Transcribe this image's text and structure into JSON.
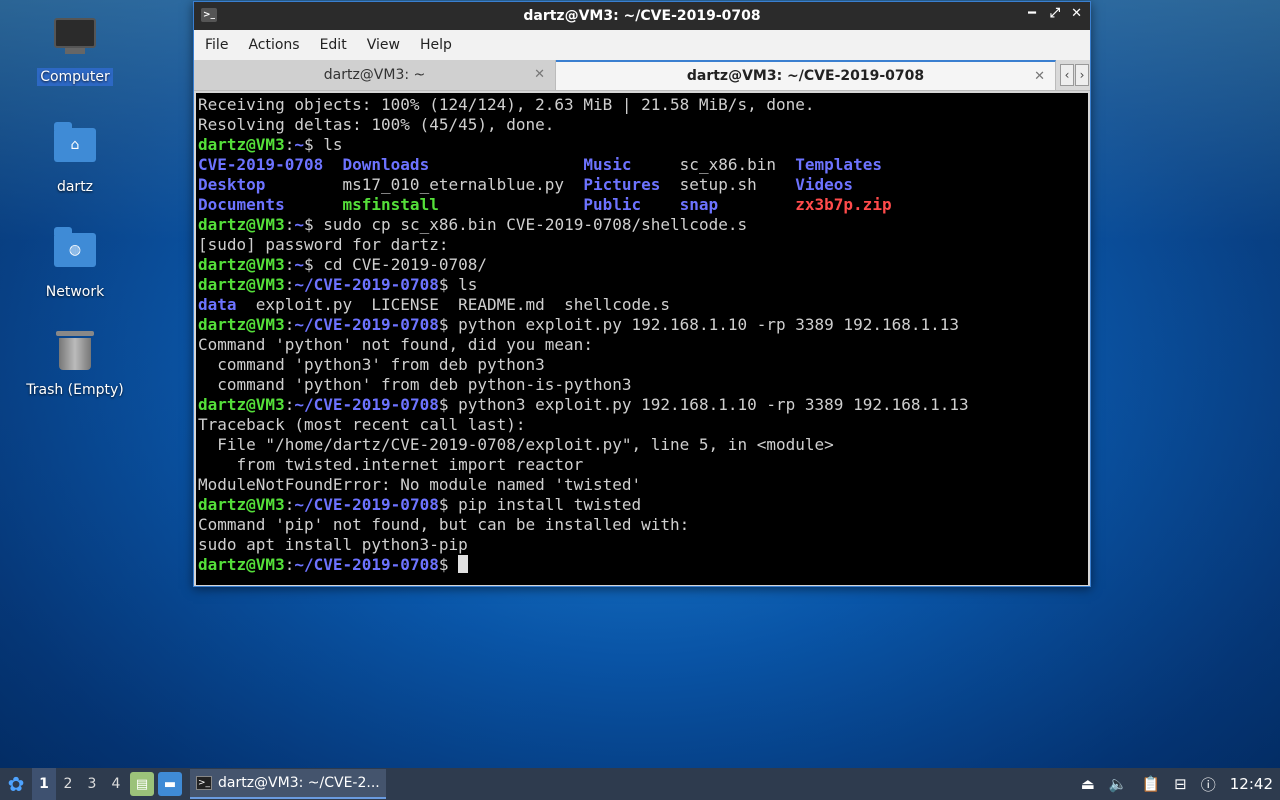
{
  "desktop": {
    "icons": [
      {
        "label": "Computer"
      },
      {
        "label": "dartz"
      },
      {
        "label": "Network"
      },
      {
        "label": "Trash (Empty)"
      }
    ]
  },
  "window": {
    "title": "dartz@VM3: ~/CVE-2019-0708",
    "menu": [
      "File",
      "Actions",
      "Edit",
      "View",
      "Help"
    ],
    "tabs": [
      {
        "label": "dartz@VM3: ~",
        "active": false
      },
      {
        "label": "dartz@VM3: ~/CVE-2019-0708",
        "active": true
      }
    ]
  },
  "terminal": {
    "lines": [
      {
        "type": "out",
        "text": "Receiving objects: 100% (124/124), 2.63 MiB | 21.58 MiB/s, done."
      },
      {
        "type": "out",
        "text": "Resolving deltas: 100% (45/45), done."
      },
      {
        "type": "cmd",
        "user": "dartz@VM3",
        "path": "~",
        "cmd": " ls"
      },
      {
        "type": "ls",
        "cells": [
          {
            "t": "CVE-2019-0708",
            "c": "dir"
          },
          {
            "t": "Downloads",
            "c": "dir"
          },
          {
            "t": "Music",
            "c": "dir"
          },
          {
            "t": "sc_x86.bin",
            "c": "file"
          },
          {
            "t": "Templates",
            "c": "dir"
          }
        ]
      },
      {
        "type": "ls",
        "cells": [
          {
            "t": "Desktop",
            "c": "dir"
          },
          {
            "t": "ms17_010_eternalblue.py",
            "c": "file"
          },
          {
            "t": "Pictures",
            "c": "dir"
          },
          {
            "t": "setup.sh",
            "c": "file"
          },
          {
            "t": "Videos",
            "c": "dir"
          }
        ]
      },
      {
        "type": "ls",
        "cells": [
          {
            "t": "Documents",
            "c": "dir"
          },
          {
            "t": "msfinstall",
            "c": "exe"
          },
          {
            "t": "Public",
            "c": "dir"
          },
          {
            "t": "snap",
            "c": "dir"
          },
          {
            "t": "zx3b7p.zip",
            "c": "arc"
          }
        ]
      },
      {
        "type": "cmd",
        "user": "dartz@VM3",
        "path": "~",
        "cmd": " sudo cp sc_x86.bin CVE-2019-0708/shellcode.s"
      },
      {
        "type": "out",
        "text": "[sudo] password for dartz:"
      },
      {
        "type": "cmd",
        "user": "dartz@VM3",
        "path": "~",
        "cmd": " cd CVE-2019-0708/"
      },
      {
        "type": "cmd",
        "user": "dartz@VM3",
        "path": "~/CVE-2019-0708",
        "cmd": " ls"
      },
      {
        "type": "ls2",
        "cells": [
          {
            "t": "data",
            "c": "dir"
          },
          {
            "t": "exploit.py",
            "c": "file"
          },
          {
            "t": "LICENSE",
            "c": "file"
          },
          {
            "t": "README.md",
            "c": "file"
          },
          {
            "t": "shellcode.s",
            "c": "file"
          }
        ]
      },
      {
        "type": "cmd",
        "user": "dartz@VM3",
        "path": "~/CVE-2019-0708",
        "cmd": " python exploit.py 192.168.1.10 -rp 3389 192.168.1.13"
      },
      {
        "type": "out",
        "text": "Command 'python' not found, did you mean:"
      },
      {
        "type": "out",
        "text": "  command 'python3' from deb python3"
      },
      {
        "type": "out",
        "text": "  command 'python' from deb python-is-python3"
      },
      {
        "type": "cmd",
        "user": "dartz@VM3",
        "path": "~/CVE-2019-0708",
        "cmd": " python3 exploit.py 192.168.1.10 -rp 3389 192.168.1.13"
      },
      {
        "type": "out",
        "text": "Traceback (most recent call last):"
      },
      {
        "type": "out",
        "text": "  File \"/home/dartz/CVE-2019-0708/exploit.py\", line 5, in <module>"
      },
      {
        "type": "out",
        "text": "    from twisted.internet import reactor"
      },
      {
        "type": "out",
        "text": "ModuleNotFoundError: No module named 'twisted'"
      },
      {
        "type": "cmd",
        "user": "dartz@VM3",
        "path": "~/CVE-2019-0708",
        "cmd": " pip install twisted"
      },
      {
        "type": "out",
        "text": "Command 'pip' not found, but can be installed with:"
      },
      {
        "type": "out",
        "text": "sudo apt install python3-pip"
      },
      {
        "type": "prompt",
        "user": "dartz@VM3",
        "path": "~/CVE-2019-0708",
        "cmd": " "
      }
    ]
  },
  "taskbar": {
    "workspaces": [
      "1",
      "2",
      "3",
      "4"
    ],
    "current_workspace": "1",
    "task_label": "dartz@VM3: ~/CVE-2...",
    "clock": "12:42"
  },
  "colors": {
    "prompt_user": "#55e03a",
    "prompt_path": "#6d73ff",
    "archive": "#ff4b4b",
    "desktop_bg": "#0a5fb8"
  }
}
